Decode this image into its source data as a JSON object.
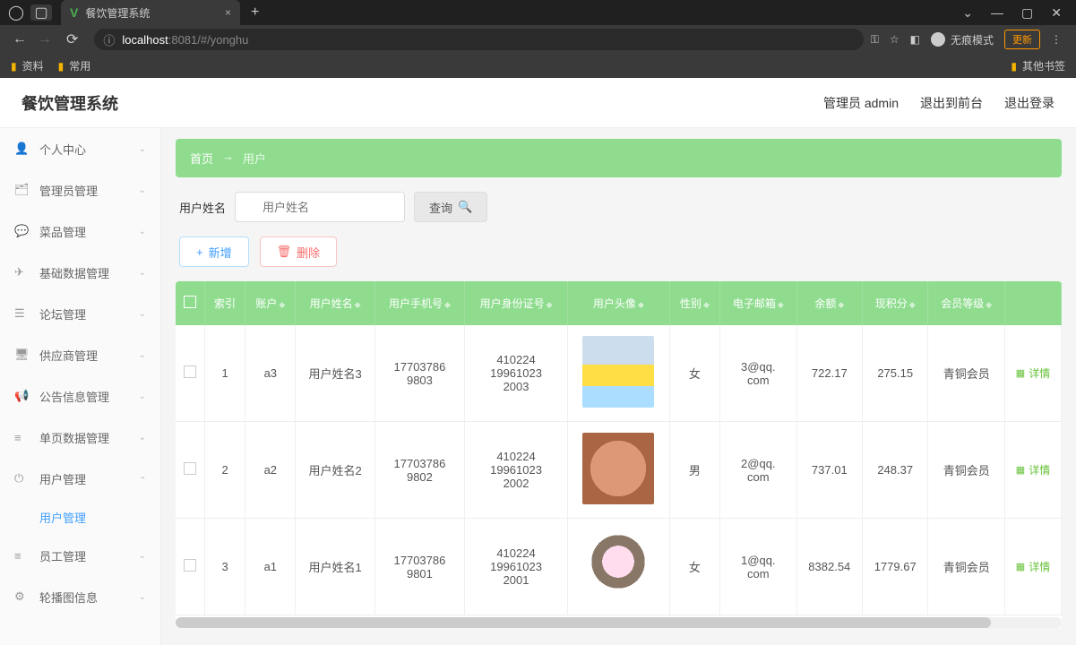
{
  "browser": {
    "tab_title": "餐饮管理系统",
    "url_host": "localhost",
    "url_rest": ":8081/#/yonghu",
    "bookmarks": [
      "资料",
      "常用"
    ],
    "bookmark_right": "其他书签",
    "incognito_label": "无痕模式",
    "update_label": "更新"
  },
  "header": {
    "title": "餐饮管理系统",
    "admin_label": "管理员 admin",
    "exit_front": "退出到前台",
    "logout": "退出登录"
  },
  "sidebar": {
    "items": [
      {
        "icon": "👤",
        "label": "个人中心"
      },
      {
        "icon": "🗂",
        "label": "管理员管理"
      },
      {
        "icon": "💬",
        "label": "菜品管理"
      },
      {
        "icon": "✈",
        "label": "基础数据管理"
      },
      {
        "icon": "☰",
        "label": "论坛管理"
      },
      {
        "icon": "🖥",
        "label": "供应商管理"
      },
      {
        "icon": "📢",
        "label": "公告信息管理"
      },
      {
        "icon": "≡",
        "label": "单页数据管理"
      },
      {
        "icon": "⏻",
        "label": "用户管理",
        "expanded": true,
        "sub": "用户管理"
      },
      {
        "icon": "≡",
        "label": "员工管理"
      },
      {
        "icon": "⚙",
        "label": "轮播图信息"
      }
    ]
  },
  "breadcrumb": {
    "home": "首页",
    "arrow": "→",
    "current": "用户"
  },
  "filter": {
    "label": "用户姓名",
    "placeholder": "用户姓名",
    "query_btn": "查询"
  },
  "actions": {
    "add": "新增",
    "delete": "删除"
  },
  "table": {
    "headers": [
      "",
      "索引",
      "账户",
      "用户姓名",
      "用户手机号",
      "用户身份证号",
      "用户头像",
      "性别",
      "电子邮箱",
      "余额",
      "现积分",
      "会员等级",
      ""
    ],
    "rows": [
      {
        "idx": "1",
        "account": "a3",
        "name": "用户姓名3",
        "phone": "177037869803",
        "idcard": "410224199610232003",
        "gender": "女",
        "email": "3@qq.com",
        "balance": "722.17",
        "points": "275.15",
        "level": "青铜会员"
      },
      {
        "idx": "2",
        "account": "a2",
        "name": "用户姓名2",
        "phone": "177037869802",
        "idcard": "410224199610232002",
        "gender": "男",
        "email": "2@qq.com",
        "balance": "737.01",
        "points": "248.37",
        "level": "青铜会员"
      },
      {
        "idx": "3",
        "account": "a1",
        "name": "用户姓名1",
        "phone": "177037869801",
        "idcard": "410224199610232001",
        "gender": "女",
        "email": "1@qq.com",
        "balance": "8382.54",
        "points": "1779.67",
        "level": "青铜会员"
      }
    ],
    "detail_label": "详情"
  }
}
